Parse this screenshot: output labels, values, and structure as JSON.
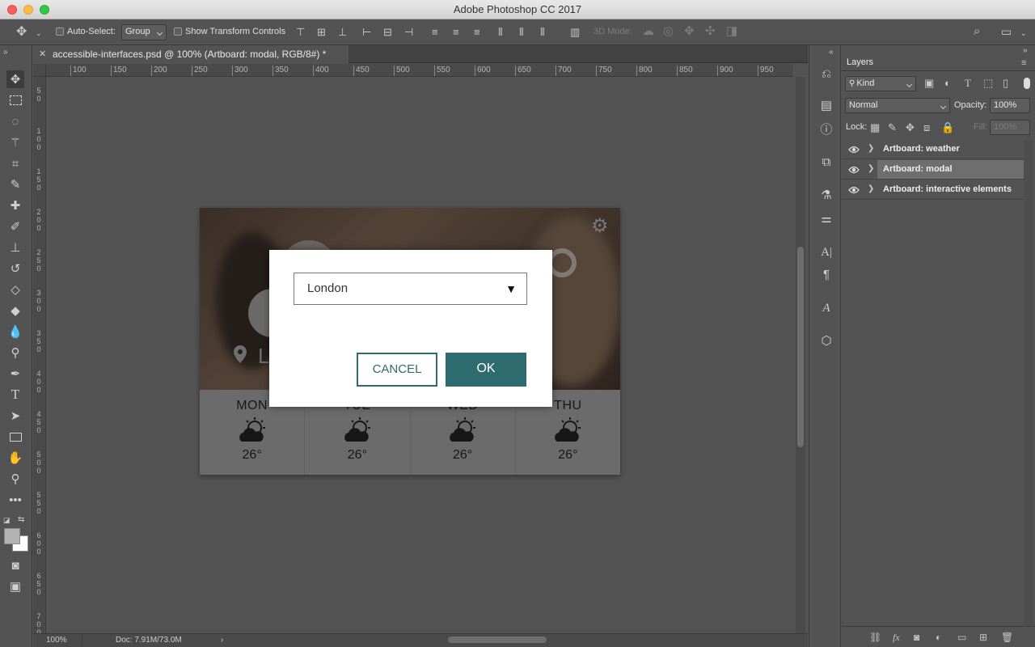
{
  "app": {
    "window_title": "Adobe Photoshop CC 2017"
  },
  "options_bar": {
    "auto_select_label": "Auto-Select:",
    "auto_select_value": "Group",
    "show_transform_label": "Show Transform Controls",
    "mode_3d_label": "3D Mode:"
  },
  "document": {
    "tab_title": "accessible-interfaces.psd @ 100% (Artboard: modal, RGB/8#) *",
    "zoom": "100%",
    "doc_size": "Doc: 7.91M/73.0M"
  },
  "rulers": {
    "horizontal": [
      "100",
      "150",
      "200",
      "250",
      "300",
      "350",
      "400",
      "450",
      "500",
      "550",
      "600",
      "650",
      "700",
      "750",
      "800",
      "850",
      "900",
      "950"
    ],
    "vertical": [
      "5\n0",
      "1\n0\n0",
      "1\n5\n0",
      "2\n0\n0",
      "2\n5\n0",
      "3\n0\n0",
      "3\n5\n0",
      "4\n0\n0",
      "4\n5\n0",
      "5\n0\n0",
      "5\n5\n0",
      "6\n0\n0",
      "6\n5\n0",
      "7\n0\n0"
    ]
  },
  "artboard": {
    "location_partial": "L",
    "forecast": [
      {
        "day": "MON",
        "temp": "26°"
      },
      {
        "day": "TUE",
        "temp": "26°"
      },
      {
        "day": "WED",
        "temp": "26°"
      },
      {
        "day": "THU",
        "temp": "26°"
      }
    ]
  },
  "modal": {
    "dropdown_value": "London",
    "dropdown_arrow": "▼",
    "cancel_label": "CANCEL",
    "ok_label": "OK",
    "accent_color": "#2e6b6e"
  },
  "layers_panel": {
    "title": "Layers",
    "filter_kind": "Kind",
    "blend_mode": "Normal",
    "opacity_label": "Opacity:",
    "opacity_value": "100%",
    "lock_label": "Lock:",
    "fill_label": "Fill:",
    "fill_value": "100%",
    "layers": [
      {
        "name": "Artboard: weather",
        "selected": false
      },
      {
        "name": "Artboard: modal",
        "selected": true
      },
      {
        "name": "Artboard: interactive elements",
        "selected": false
      }
    ],
    "bottom_fx": "fx"
  }
}
